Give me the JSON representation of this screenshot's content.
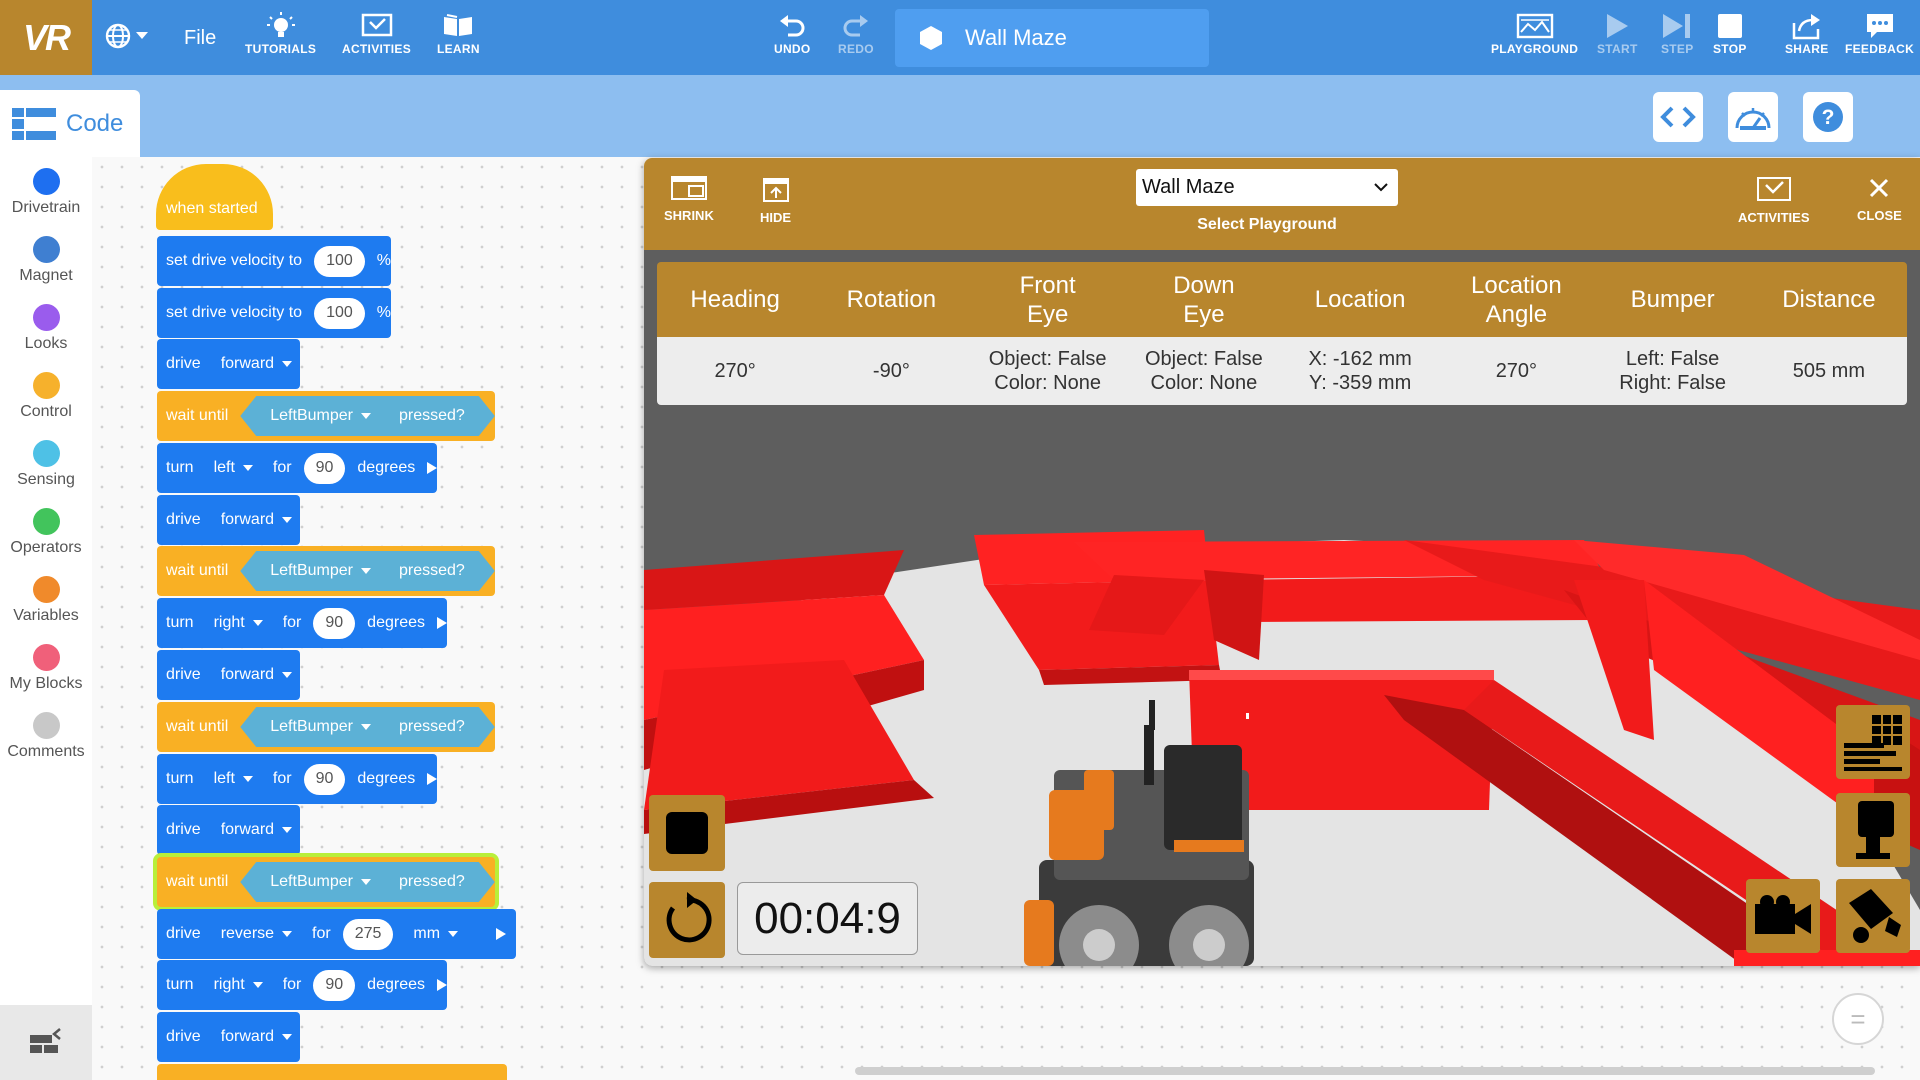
{
  "app": {
    "logo": "VR",
    "file_menu": "File"
  },
  "toolbar": {
    "tutorials": "TUTORIALS",
    "activities": "ACTIVITIES",
    "learn": "LEARN",
    "undo": "UNDO",
    "redo": "REDO",
    "project_name": "Wall Maze",
    "playground": "PLAYGROUND",
    "start": "START",
    "step": "STEP",
    "stop": "STOP",
    "share": "SHARE",
    "feedback": "FEEDBACK"
  },
  "code_tab": {
    "label": "Code"
  },
  "categories": [
    {
      "label": "Drivetrain",
      "color": "#1e6ff0"
    },
    {
      "label": "Magnet",
      "color": "#3f7fd1"
    },
    {
      "label": "Looks",
      "color": "#9a5ced"
    },
    {
      "label": "Control",
      "color": "#f6b12c"
    },
    {
      "label": "Sensing",
      "color": "#4ec1e6"
    },
    {
      "label": "Operators",
      "color": "#42c45c"
    },
    {
      "label": "Variables",
      "color": "#f08a2b"
    },
    {
      "label": "My Blocks",
      "color": "#f0607a"
    },
    {
      "label": "Comments",
      "color": "#c8c8c8"
    }
  ],
  "blocks": {
    "hat": "when started",
    "set_velocity": "set drive velocity to",
    "velocity_value": "100",
    "percent": "%",
    "drive": "drive",
    "forward": "forward",
    "reverse": "reverse",
    "wait_until": "wait until",
    "left_bumper": "LeftBumper",
    "pressed": "pressed?",
    "turn": "turn",
    "left": "left",
    "right": "right",
    "for": "for",
    "deg_value": "90",
    "degrees": "degrees",
    "mm_value": "275",
    "mm": "mm"
  },
  "playground": {
    "shrink": "SHRINK",
    "hide": "HIDE",
    "selected": "Wall Maze",
    "select_label": "Select Playground",
    "activities": "ACTIVITIES",
    "close": "CLOSE",
    "timer": "00:04:9"
  },
  "sensors": {
    "headers": [
      "Heading",
      "Rotation",
      "Front\nEye",
      "Down\nEye",
      "Location",
      "Location\nAngle",
      "Bumper",
      "Distance"
    ],
    "heading": "270°",
    "rotation": "-90°",
    "front_eye_object": "Object: False",
    "front_eye_color": "Color: None",
    "down_eye_object": "Object: False",
    "down_eye_color": "Color: None",
    "location_x": "X: -162 mm",
    "location_y": "Y: -359 mm",
    "location_angle": "270°",
    "bumper_left": "Left: False",
    "bumper_right": "Right: False",
    "distance": "505 mm"
  },
  "colors": {
    "topbar": "#3f8ddd",
    "brand_gold": "#b8862d",
    "wall_red": "#f21b1b",
    "block_blue": "#1e7bf0",
    "block_yellow": "#f9b024"
  }
}
